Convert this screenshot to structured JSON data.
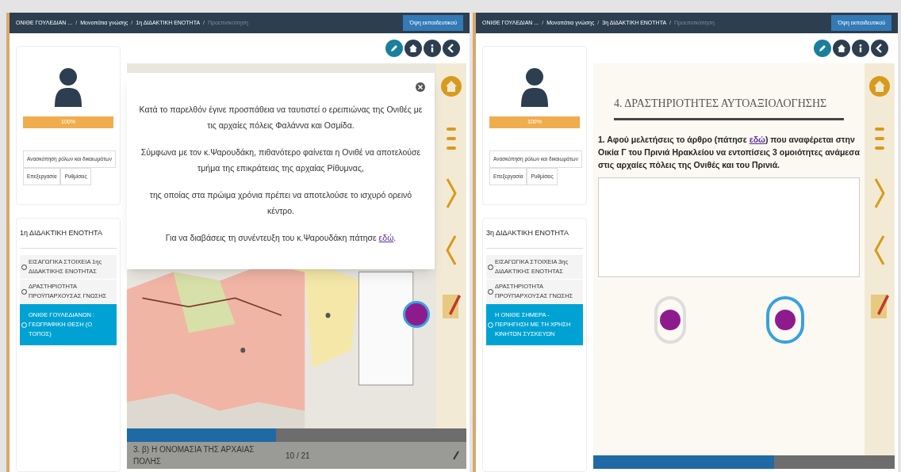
{
  "screens": [
    {
      "breadcrumb": [
        {
          "label": "ΟΝΙΘΕ ΓΟΥΛΕΔΙΑΝ ...",
          "current": false
        },
        {
          "label": "Μονοπάτια γνώσης",
          "current": false
        },
        {
          "label": "1η ΔΙΔΑΚΤΙΚΗ ΕΝΟΤΗΤΑ",
          "current": false
        },
        {
          "label": "Προεπισκόπηση",
          "current": true
        }
      ],
      "separators": [
        "/",
        "/",
        "/"
      ],
      "view_button": "Όψη εκπαιδευτικού",
      "progress": {
        "level": 1,
        "label": "100%"
      },
      "review_button": "Ανασκόπηση ρόλων και δικαιωμάτων",
      "edit_button": "Επεξεργασία",
      "settings_button": "Ρυθμίσεις",
      "unit": {
        "title": "1η ΔΙΔΑΚΤΙΚΗ ΕΝΟΤΗΤΑ",
        "items": [
          {
            "label": "ΕΙΣΑΓΩΓΙΚΑ ΣΤΟΙΧΕΙΑ 1ης ΔΙΔΑΚΤΙΚΗΣ ΕΝΟΤΗΤΑΣ",
            "selected": false
          },
          {
            "label": "ΔΡΑΣΤΗΡΙΟΤΗΤΑ ΠΡΟΫΠΑΡΧΟΥΣΑΣ ΓΝΩΣΗΣ",
            "selected": false
          },
          {
            "label": "ΟΝΙΘΕ ΓΟΥΛΕΔΙΑΝΩΝ : ΓΕΩΓΡΑΦΙΚΗ ΘΕΣΗ (Ο ΤΟΠΟΣ)",
            "selected": true
          }
        ]
      },
      "slide": {
        "kind": "map",
        "modal": {
          "paragraphs": [
            {
              "text": "Κατά το παρελθόν έγινε προσπάθεια να ταυτιστεί ο ερειπιώνας της Ονιθές με τις αρχαίες πόλεις Φαλάννα και Οσμίδα."
            },
            {
              "text": "Σύμφωνα με τον κ.Ψαρουδάκη, πιθανότερο φαίνεται η Ονιθέ να αποτελούσε τμήμα της επικράτειας της αρχαίας Ρίθυμνας,"
            },
            {
              "text": "της οποίας στα πρώιμα χρόνια πρέπει να αποτελούσε το ισχυρό ορεινό κέντρο."
            },
            {
              "text": "Για να διαβάσεις τη συνέντευξη του κ.Ψαρουδάκη πάτησε",
              "link": "εδώ",
              "after": "."
            }
          ]
        },
        "track": {
          "level": 0.44
        },
        "title": "3. β) Η ΟΝΟΜΑΣΙΑ ΤΗΣ ΑΡΧΑΙΑΣ ΠΟΛΗΣ",
        "pager": "10 / 21"
      }
    },
    {
      "breadcrumb": [
        {
          "label": "ΟΝΙΘΕ ΓΟΥΛΕΔΙΑΝ ...",
          "current": false
        },
        {
          "label": "Μονοπάτια γνώσης",
          "current": false
        },
        {
          "label": "3η ΔΙΔΑΚΤΙΚΗ ΕΝΟΤΗΤΑ",
          "current": false
        },
        {
          "label": "Προεπισκόπηση",
          "current": true
        }
      ],
      "separators": [
        "/",
        "/",
        "/"
      ],
      "view_button": "Όψη εκπαιδευτικού",
      "progress": {
        "level": 1,
        "label": "100%"
      },
      "review_button": "Ανασκόπηση ρόλων και δικαιωμάτων",
      "edit_button": "Επεξεργασία",
      "settings_button": "Ρυθμίσεις",
      "unit": {
        "title": "3η ΔΙΔΑΚΤΙΚΗ ΕΝΟΤΗΤΑ",
        "items": [
          {
            "label": "ΕΙΣΑΓΩΓΙΚΑ ΣΤΟΙΧΕΙΑ 3ης ΔΙΔΑΚΤΙΚΗΣ ΕΝΟΤΗΤΑΣ",
            "selected": false
          },
          {
            "label": "ΔΡΑΣΤΗΡΙΟΤΗΤΑ ΠΡΟΫΠΑΡΧΟΥΣΑΣ ΓΝΩΣΗΣ",
            "selected": false
          },
          {
            "label": "Η ΟΝΙΘΕ ΣΗΜΕΡΑ - ΠΕΡΙΗΓΗΣΗ ΜΕ ΤΗ ΧΡΗΣΗ ΚΙΝΗΤΩΝ ΣΥΣΚΕΥΩΝ",
            "selected": true
          }
        ]
      },
      "slide": {
        "kind": "quiz",
        "heading": "4. ΔΡΑΣΤΗΡΙΟΤΗΤΕΣ ΑΥΤΟΑΞΙΟΛΟΓΗΣΗΣ",
        "question": {
          "before": "1. Αφού μελετήσεις το άρθρο (πάτησε",
          "link": "εδώ",
          "after": ") που αναφέρεται στην Οικία Γ του Πρινιά Ηρακλείου να εντοπίσεις 3 ομοιότητες ανάμεσα στις αρχαίες πόλεις της Ονιθές και του Πρινιά."
        },
        "track": {
          "level": 0.6
        }
      }
    }
  ]
}
